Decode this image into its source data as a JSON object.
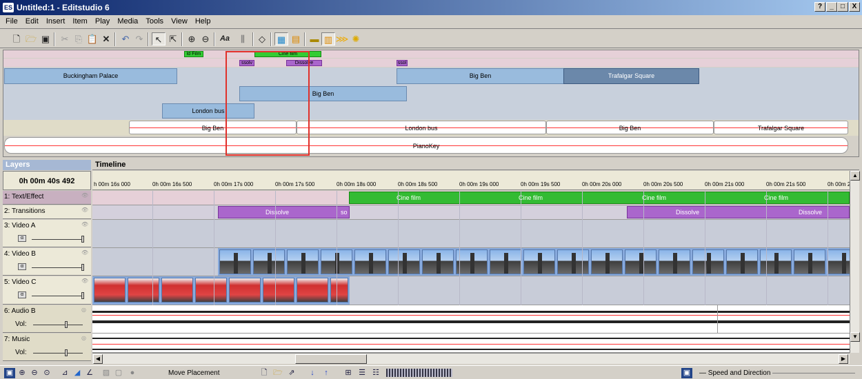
{
  "window": {
    "app_icon": "ES",
    "title": "Untitled:1 - Editstudio 6",
    "min": "_",
    "max": "□",
    "close": "X",
    "help_btn": "?"
  },
  "menu": [
    "File",
    "Edit",
    "Insert",
    "Item",
    "Play",
    "Media",
    "Tools",
    "View",
    "Help"
  ],
  "overview": {
    "text_clips": [
      "ld Film",
      "Cine film"
    ],
    "transition_clips": [
      "ssolv",
      "Dissolve",
      "ssol"
    ],
    "row3": [
      "Buckingham Palace",
      "Big Ben",
      "Trafalgar Square"
    ],
    "row4": [
      "Big Ben"
    ],
    "row5": [
      "London bus"
    ],
    "audio_row": [
      "Big Ben",
      "London bus",
      "Big Ben",
      "Trafalgar Square"
    ],
    "music_row": [
      "PianoKey"
    ]
  },
  "layers": {
    "header": "Layers",
    "time": "0h 00m 40s 492",
    "items": [
      {
        "name": "1: Text/Effect"
      },
      {
        "name": "2: Transitions"
      },
      {
        "name": "3: Video A"
      },
      {
        "name": "4: Video B"
      },
      {
        "name": "5: Video C"
      },
      {
        "name": "6: Audio B",
        "vol": "Vol:"
      },
      {
        "name": "7: Music",
        "vol": "Vol:"
      }
    ]
  },
  "timeline": {
    "header": "Timeline",
    "ticks": [
      "h 00m 16s 000",
      "0h 00m 16s 500",
      "0h 00m 17s 000",
      "0h 00m 17s 500",
      "0h 00m 18s 000",
      "0h 00m 18s 500",
      "0h 00m 19s 000",
      "0h 00m 19s 500",
      "0h 00m 20s 000",
      "0h 00m 20s 500",
      "0h 00m 21s 000",
      "0h 00m 21s 500",
      "0h 00m 2"
    ],
    "text_clip_labels": [
      "Cine film",
      "Cine film",
      "Cine film",
      "Cine film"
    ],
    "transition_labels": [
      "Dissolve",
      "so",
      "Dissolve",
      "Dissolve"
    ]
  },
  "bottombar": {
    "mode_label": "Move Placement",
    "speed_label": "Speed and Direction"
  },
  "colors": {
    "text_clip": "#33cc33",
    "transition_clip": "#aa66cc",
    "video_clip": "#99bbdd",
    "selected_clip": "#6b88aa",
    "highlight_box": "#e0302a"
  }
}
